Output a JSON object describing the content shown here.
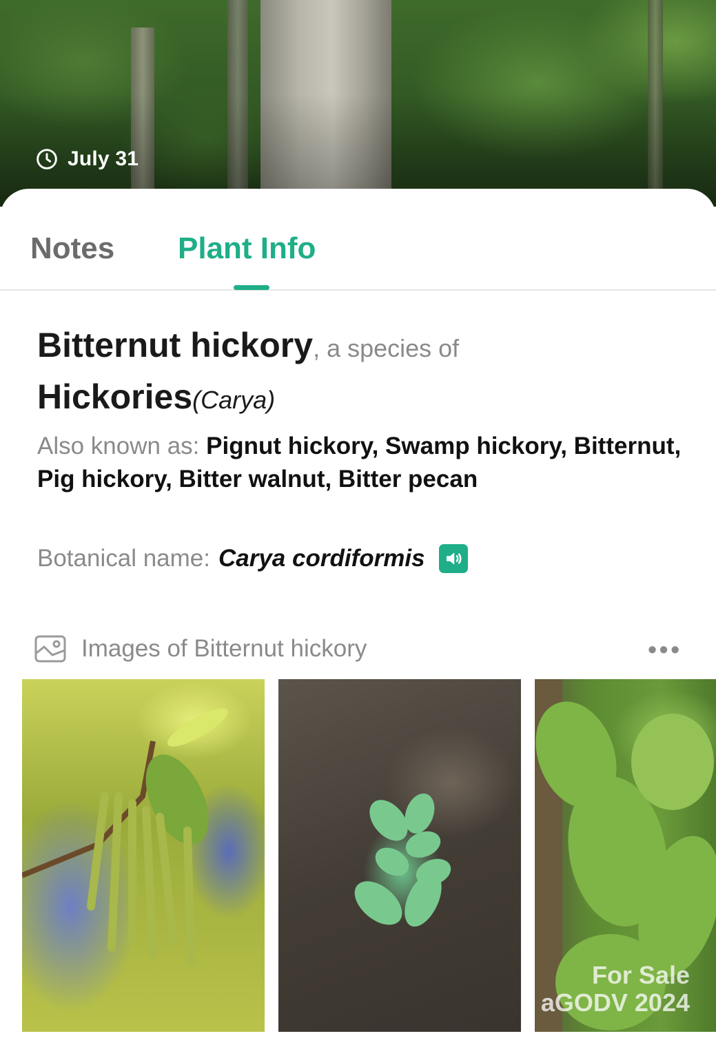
{
  "hero": {
    "date": "July 31"
  },
  "tabs": {
    "notes": "Notes",
    "plant_info": "Plant Info"
  },
  "plant": {
    "common_name": "Bitternut hickory",
    "species_of": ", a species of",
    "genus_common": "Hickories",
    "genus_scientific": "(Carya)",
    "aka_label": "Also known as: ",
    "aka_names": "Pignut hickory, Swamp hickory, Bitternut, Pig hickory, Bitter walnut, Bitter pecan",
    "botanical_label": "Botanical name:",
    "botanical_name": "Carya cordiformis"
  },
  "images": {
    "title": "Images of Bitternut hickory",
    "more": "•••",
    "watermark_line1": "For Sale",
    "watermark_line2": "aGODV 2024"
  },
  "colors": {
    "accent": "#1fae88",
    "muted": "#8a8a8a",
    "text": "#1a1a1a"
  }
}
